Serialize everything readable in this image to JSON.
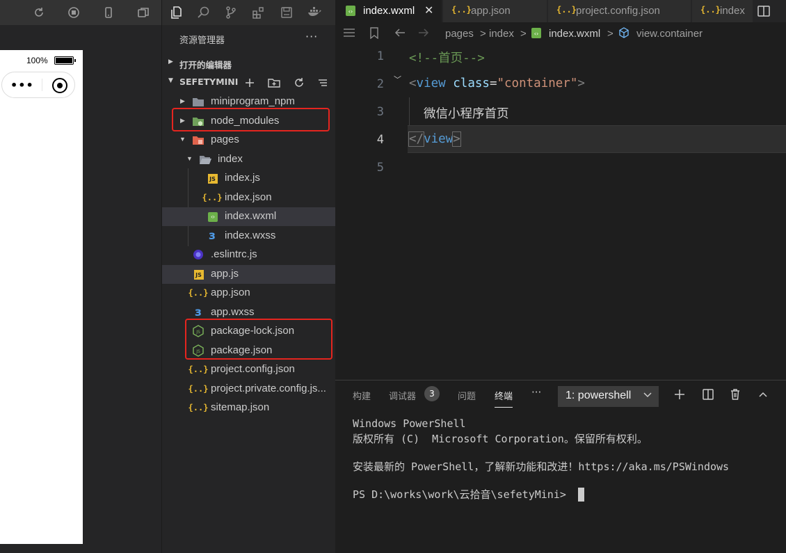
{
  "simulator": {
    "battery_text": "100%",
    "toolbar_icons": [
      "refresh-icon",
      "stop-icon",
      "phone-icon",
      "window-icon"
    ]
  },
  "activity_bar": {
    "icons": [
      "files-icon",
      "search-icon",
      "source-control-icon",
      "extensions-icon",
      "save-icon",
      "docker-icon"
    ]
  },
  "explorer": {
    "title": "资源管理器",
    "more": "···",
    "open_editors": "打开的编辑器",
    "project": "SEFETYMINI",
    "tree": [
      {
        "name": "miniprogram_npm",
        "type": "folder"
      },
      {
        "name": "node_modules",
        "type": "folder-node"
      },
      {
        "name": "pages",
        "type": "folder-pages"
      },
      {
        "name": "index",
        "type": "folder-open"
      },
      {
        "name": "index.js",
        "type": "js"
      },
      {
        "name": "index.json",
        "type": "json"
      },
      {
        "name": "index.wxml",
        "type": "wxml"
      },
      {
        "name": "index.wxss",
        "type": "css"
      },
      {
        "name": ".eslintrc.js",
        "type": "eslint"
      },
      {
        "name": "app.js",
        "type": "js"
      },
      {
        "name": "app.json",
        "type": "json"
      },
      {
        "name": "app.wxss",
        "type": "css"
      },
      {
        "name": "package-lock.json",
        "type": "node"
      },
      {
        "name": "package.json",
        "type": "node"
      },
      {
        "name": "project.config.json",
        "type": "json"
      },
      {
        "name": "project.private.config.js...",
        "type": "json"
      },
      {
        "name": "sitemap.json",
        "type": "json"
      }
    ]
  },
  "tabs": [
    {
      "label": "index.wxml",
      "close": "✕"
    },
    {
      "label": "app.json"
    },
    {
      "label": "project.config.json"
    },
    {
      "label": "index"
    }
  ],
  "breadcrumb": {
    "items": [
      "pages",
      "index",
      "index.wxml",
      "view.container"
    ],
    "separators": [
      ">",
      ">",
      ">"
    ]
  },
  "code": {
    "line_numbers": [
      "1",
      "2",
      "3",
      "4",
      "5"
    ],
    "line1_comment": "<!--首页-->",
    "line2": {
      "open": "<",
      "tag": "view",
      "attr": "class",
      "eq": "=",
      "value": "\"container\"",
      "close": ">"
    },
    "line3_text": "微信小程序首页",
    "line4": {
      "open": "</",
      "tag": "view",
      "close": ">"
    }
  },
  "panel": {
    "tabs": [
      "构建",
      "调试器",
      "问题",
      "终端"
    ],
    "debugger_badge": "3",
    "more": "···",
    "terminal_select": "1: powershell",
    "terminal_lines": [
      "Windows PowerShell",
      "版权所有 (C)  Microsoft Corporation。保留所有权利。",
      "",
      "安装最新的 PowerShell，了解新功能和改进！https://aka.ms/PSWindows",
      "",
      "PS D:\\works\\work\\云拾音\\sefetyMini> "
    ]
  },
  "colors": {
    "highlight_box": "#e5251f",
    "accent_json": "#e8b931",
    "accent_css": "#4f9be8",
    "accent_wxml": "#6cb04a"
  }
}
